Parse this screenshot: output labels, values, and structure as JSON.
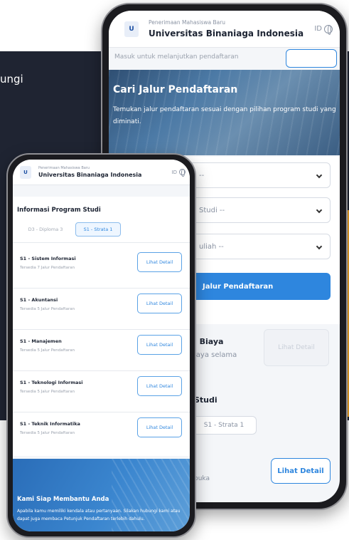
{
  "background": {
    "text": "ungi"
  },
  "back_phone": {
    "header": {
      "subtitle": "Penerimaan Mahasiswa Baru",
      "title": "Universitas Binaniaga Indonesia",
      "lang": "ID"
    },
    "scroll_text": "Masuk untuk melanjutkan pendaftaran",
    "hero": {
      "title": "Cari Jalur Pendaftaran",
      "description": "Temukan jalur pendaftaran sesuai dengan pilihan program studi yang diminati."
    },
    "selects": [
      {
        "label": "--"
      },
      {
        "label": "Studi --"
      },
      {
        "label": "uliah --"
      }
    ],
    "search_button": "Jalur Pendaftaran",
    "biaya": {
      "title": "i Biaya",
      "desc": "iaya selama",
      "button": "Lihat Detail"
    },
    "studi": {
      "title": "Studi",
      "chip": "S1 - Strata 1"
    },
    "detail_button": "Lihat Detail",
    "buka_text": "buka"
  },
  "front_phone": {
    "header": {
      "subtitle": "Penerimaan Mahasiswa Baru",
      "title": "Universitas Binaniaga Indonesia",
      "lang": "ID"
    },
    "info_title": "Informasi Program Studi",
    "chips": {
      "d3": "D3 - Diploma 3",
      "s1": "S1 - Strata 1"
    },
    "programs": [
      {
        "name": "S1 - Sistem Informasi",
        "sub": "Tersedia 7 Jalur Pendaftaran",
        "button": "Lihat Detail"
      },
      {
        "name": "S1 - Akuntansi",
        "sub": "Tersedia 5 Jalur Pendaftaran",
        "button": "Lihat Detail"
      },
      {
        "name": "S1 - Manajemen",
        "sub": "Tersedia 5 Jalur Pendaftaran",
        "button": "Lihat Detail"
      },
      {
        "name": "S1 - Teknologi Informasi",
        "sub": "Tersedia 5 Jalur Pendaftaran",
        "button": "Lihat Detail"
      },
      {
        "name": "S1 - Teknik Informatika",
        "sub": "Tersedia 5 Jalur Pendaftaran",
        "button": "Lihat Detail"
      }
    ],
    "help": {
      "title": "Kami Siap Membantu Anda",
      "description": "Apabila kamu memiliki kendala atau pertanyaan. Silakan hubungi kami atau dapat juga membaca Petunjuk Pendaftaran terlebih dahulu."
    }
  },
  "colors": {
    "primary": "#2e86de",
    "dark": "#1f2432",
    "accent": "#f5a623"
  }
}
